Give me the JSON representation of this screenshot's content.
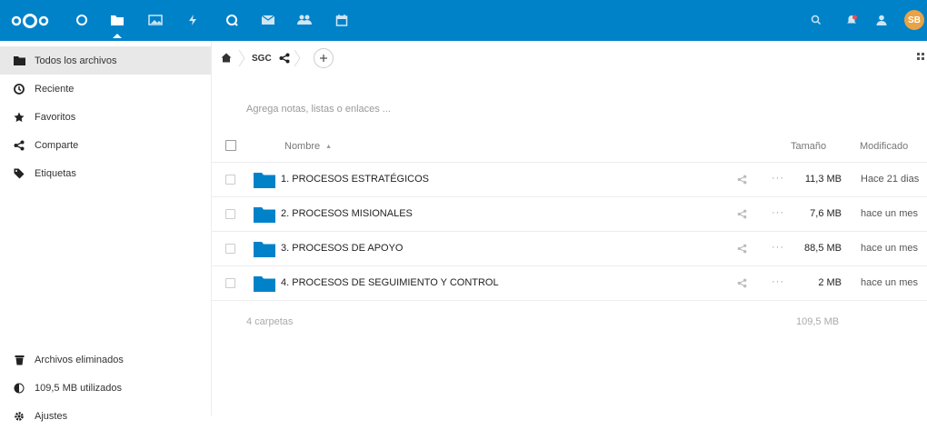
{
  "topbar": {
    "apps": [
      "dashboard-icon",
      "files-icon",
      "photos-icon",
      "activity-icon",
      "talk-icon",
      "mail-icon",
      "contacts-icon",
      "calendar-icon"
    ],
    "user_initials": "SB",
    "bg": "#0082c9"
  },
  "sidebar": {
    "items": [
      {
        "label": "Todos los archivos",
        "icon": "folder-icon"
      },
      {
        "label": "Reciente",
        "icon": "clock-icon"
      },
      {
        "label": "Favoritos",
        "icon": "star-icon"
      },
      {
        "label": "Comparte",
        "icon": "share-icon"
      },
      {
        "label": "Etiquetas",
        "icon": "tag-icon"
      }
    ],
    "bottom": {
      "deleted": "Archivos eliminados",
      "quota": "109,5 MB utilizados",
      "settings": "Ajustes"
    }
  },
  "breadcrumb": {
    "current": "SGC"
  },
  "notes_placeholder": "Agrega notas, listas o enlaces ...",
  "table": {
    "col_name": "Nombre",
    "col_size": "Tamaño",
    "col_modified": "Modificado",
    "rows": [
      {
        "name": "1. PROCESOS ESTRATÉGICOS",
        "size": "11,3 MB",
        "modified": "Hace 21 dias"
      },
      {
        "name": "2. PROCESOS MISIONALES",
        "size": "7,6 MB",
        "modified": "hace un mes"
      },
      {
        "name": "3. PROCESOS DE APOYO",
        "size": "88,5 MB",
        "modified": "hace un mes"
      },
      {
        "name": "4. PROCESOS DE SEGUIMIENTO Y CONTROL",
        "size": "2 MB",
        "modified": "hace un mes"
      }
    ],
    "summary_count": "4 carpetas",
    "summary_size": "109,5 MB",
    "more_label": "···"
  }
}
